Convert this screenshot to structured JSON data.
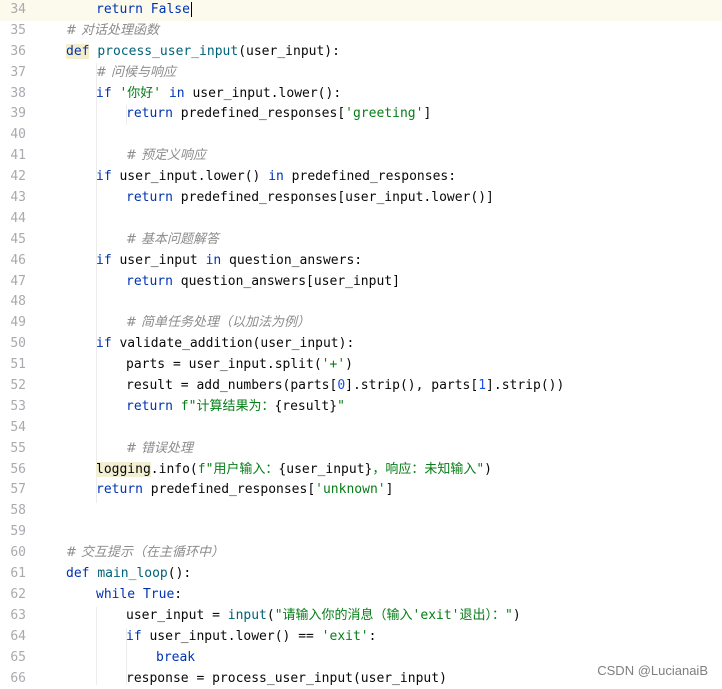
{
  "editor": {
    "lines": [
      {
        "num": "34",
        "current": true,
        "indent": 1,
        "tokens": [
          {
            "t": "return",
            "c": "kw"
          },
          {
            "t": " "
          },
          {
            "t": "False",
            "c": "kw"
          }
        ],
        "caret": true
      },
      {
        "num": "35",
        "indent": 0,
        "tokens": [
          {
            "t": "# 对话处理函数",
            "c": "cmt"
          }
        ]
      },
      {
        "num": "36",
        "indent": 0,
        "tokens": [
          {
            "t": "def",
            "c": "kw hl-def"
          },
          {
            "t": " "
          },
          {
            "t": "process_user_input",
            "c": "fn"
          },
          {
            "t": "(user_input):"
          }
        ]
      },
      {
        "num": "37",
        "indent": 1,
        "tokens": [
          {
            "t": "# 问候与响应",
            "c": "cmt"
          }
        ]
      },
      {
        "num": "38",
        "indent": 1,
        "tokens": [
          {
            "t": "if",
            "c": "kw"
          },
          {
            "t": " "
          },
          {
            "t": "'你好'",
            "c": "str"
          },
          {
            "t": " "
          },
          {
            "t": "in",
            "c": "kw"
          },
          {
            "t": " user_input.lower():"
          }
        ]
      },
      {
        "num": "39",
        "indent": 2,
        "tokens": [
          {
            "t": "return",
            "c": "kw"
          },
          {
            "t": " predefined_responses["
          },
          {
            "t": "'greeting'",
            "c": "str"
          },
          {
            "t": "]"
          }
        ]
      },
      {
        "num": "40",
        "indent": 0,
        "tokens": []
      },
      {
        "num": "41",
        "indent": 2,
        "tokens": [
          {
            "t": "# 预定义响应",
            "c": "cmt"
          }
        ]
      },
      {
        "num": "42",
        "indent": 1,
        "tokens": [
          {
            "t": "if",
            "c": "kw"
          },
          {
            "t": " user_input.lower() "
          },
          {
            "t": "in",
            "c": "kw"
          },
          {
            "t": " predefined_responses:"
          }
        ]
      },
      {
        "num": "43",
        "indent": 2,
        "tokens": [
          {
            "t": "return",
            "c": "kw"
          },
          {
            "t": " predefined_responses[user_input.lower()]"
          }
        ]
      },
      {
        "num": "44",
        "indent": 0,
        "tokens": []
      },
      {
        "num": "45",
        "indent": 2,
        "tokens": [
          {
            "t": "# 基本问题解答",
            "c": "cmt"
          }
        ]
      },
      {
        "num": "46",
        "indent": 1,
        "tokens": [
          {
            "t": "if",
            "c": "kw"
          },
          {
            "t": " user_input "
          },
          {
            "t": "in",
            "c": "kw"
          },
          {
            "t": " question_answers:"
          }
        ]
      },
      {
        "num": "47",
        "indent": 2,
        "tokens": [
          {
            "t": "return",
            "c": "kw"
          },
          {
            "t": " question_answers[user_input]"
          }
        ]
      },
      {
        "num": "48",
        "indent": 0,
        "tokens": []
      },
      {
        "num": "49",
        "indent": 2,
        "tokens": [
          {
            "t": "# 简单任务处理（以加法为例）",
            "c": "cmt"
          }
        ]
      },
      {
        "num": "50",
        "indent": 1,
        "tokens": [
          {
            "t": "if",
            "c": "kw"
          },
          {
            "t": " validate_addition(user_input):"
          }
        ]
      },
      {
        "num": "51",
        "indent": 2,
        "tokens": [
          {
            "t": "parts = user_input.split("
          },
          {
            "t": "'+'",
            "c": "str"
          },
          {
            "t": ")"
          }
        ]
      },
      {
        "num": "52",
        "indent": 2,
        "tokens": [
          {
            "t": "result = add_numbers(parts["
          },
          {
            "t": "0",
            "c": "num"
          },
          {
            "t": "].strip(), parts["
          },
          {
            "t": "1",
            "c": "num"
          },
          {
            "t": "].strip())"
          }
        ]
      },
      {
        "num": "53",
        "indent": 2,
        "tokens": [
          {
            "t": "return",
            "c": "kw"
          },
          {
            "t": " "
          },
          {
            "t": "f\"计算结果为：",
            "c": "str"
          },
          {
            "t": "{result}"
          },
          {
            "t": "\"",
            "c": "str"
          }
        ]
      },
      {
        "num": "54",
        "indent": 0,
        "tokens": []
      },
      {
        "num": "55",
        "indent": 2,
        "tokens": [
          {
            "t": "# 错误处理",
            "c": "cmt"
          }
        ]
      },
      {
        "num": "56",
        "indent": 1,
        "tokens": [
          {
            "t": "logging",
            "c": "hl-var"
          },
          {
            "t": ".info("
          },
          {
            "t": "f\"用户输入：",
            "c": "str"
          },
          {
            "t": "{user_input}"
          },
          {
            "t": "，响应：未知输入\"",
            "c": "str"
          },
          {
            "t": ")"
          }
        ]
      },
      {
        "num": "57",
        "indent": 1,
        "tokens": [
          {
            "t": "return",
            "c": "kw"
          },
          {
            "t": " predefined_responses["
          },
          {
            "t": "'unknown'",
            "c": "str"
          },
          {
            "t": "]"
          }
        ]
      },
      {
        "num": "58",
        "indent": 0,
        "tokens": []
      },
      {
        "num": "59",
        "indent": 0,
        "tokens": []
      },
      {
        "num": "60",
        "indent": 0,
        "tokens": [
          {
            "t": "# 交互提示（在主循环中）",
            "c": "cmt"
          }
        ]
      },
      {
        "num": "61",
        "indent": 0,
        "tokens": [
          {
            "t": "def",
            "c": "kw"
          },
          {
            "t": " "
          },
          {
            "t": "main_loop",
            "c": "fn"
          },
          {
            "t": "():"
          }
        ]
      },
      {
        "num": "62",
        "indent": 1,
        "tokens": [
          {
            "t": "while",
            "c": "kw"
          },
          {
            "t": " "
          },
          {
            "t": "True",
            "c": "kw"
          },
          {
            "t": ":"
          }
        ]
      },
      {
        "num": "63",
        "indent": 2,
        "tokens": [
          {
            "t": "user_input = "
          },
          {
            "t": "input",
            "c": "fn"
          },
          {
            "t": "("
          },
          {
            "t": "\"请输入你的消息（输入'exit'退出）：\"",
            "c": "str"
          },
          {
            "t": ")"
          }
        ]
      },
      {
        "num": "64",
        "indent": 2,
        "tokens": [
          {
            "t": "if",
            "c": "kw"
          },
          {
            "t": " user_input.lower() == "
          },
          {
            "t": "'exit'",
            "c": "str"
          },
          {
            "t": ":"
          }
        ]
      },
      {
        "num": "65",
        "indent": 3,
        "tokens": [
          {
            "t": "break",
            "c": "kw"
          }
        ]
      },
      {
        "num": "66",
        "indent": 2,
        "tokens": [
          {
            "t": "response = process_user_input(user_input)"
          }
        ]
      }
    ]
  },
  "watermark": "CSDN @LucianaiB"
}
